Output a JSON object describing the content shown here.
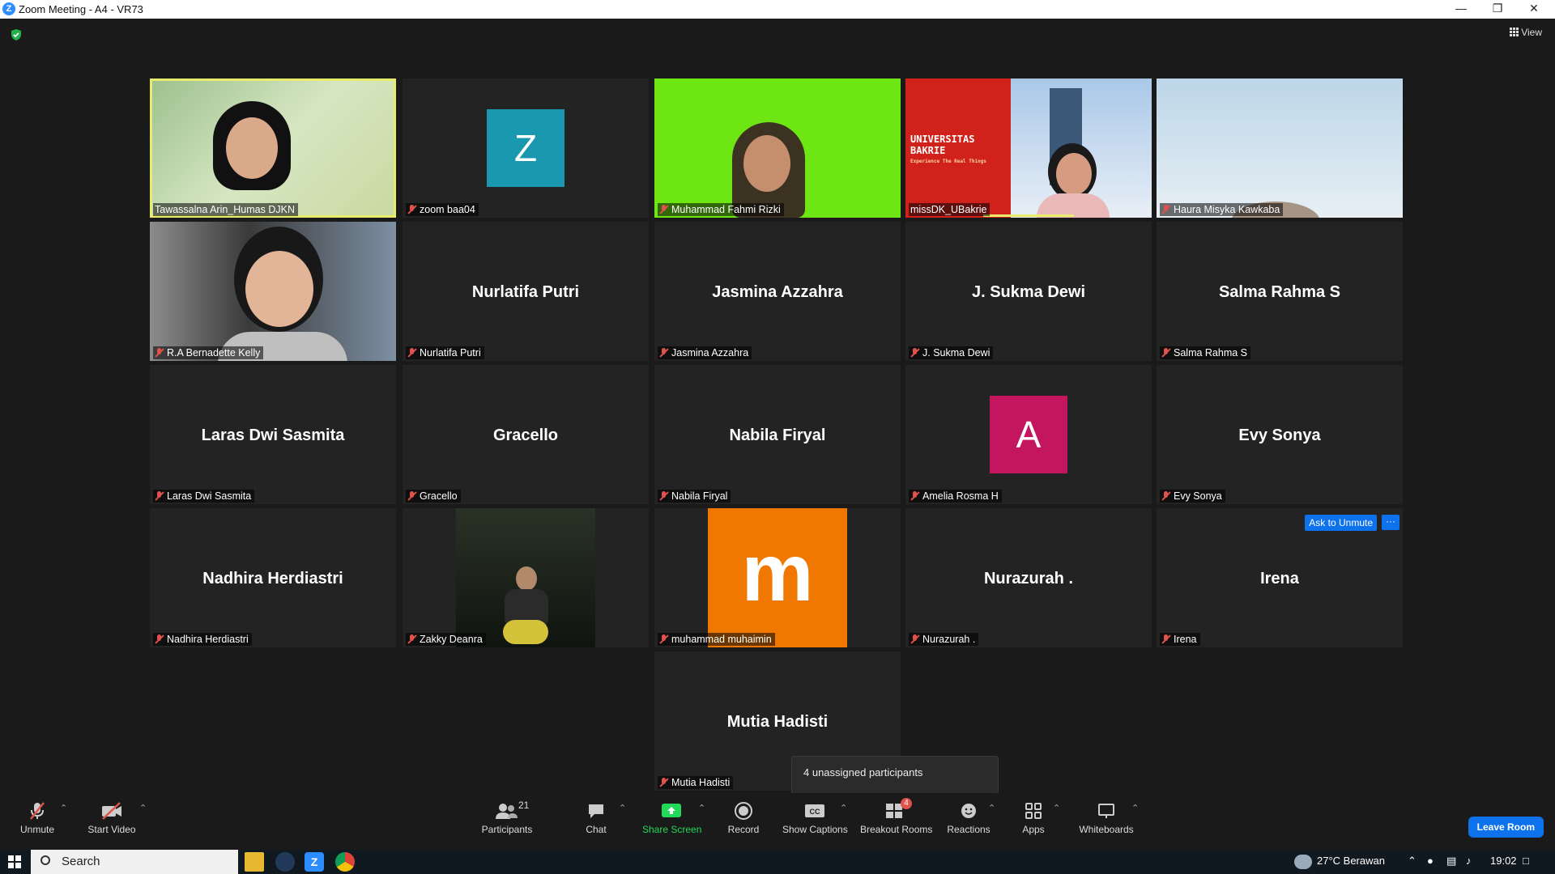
{
  "window": {
    "title": "Zoom Meeting - A4 - VR73",
    "app_letter": "Z"
  },
  "header": {
    "view_label": "View"
  },
  "tiles": [
    {
      "name": "Tawassalna Arin_Humas DJKN",
      "kind": "video"
    },
    {
      "name": "zoom baa04",
      "kind": "avatar",
      "letter": "Z",
      "color": "#1a98b0"
    },
    {
      "name": "Muhammad Fahmi Rizki",
      "kind": "video"
    },
    {
      "name": "missDK_UBakrie",
      "kind": "video",
      "banner_line1": "UNIVERSITAS",
      "banner_line2": "BAKRIE",
      "banner_line3": "Experience The Real Things"
    },
    {
      "name": "Haura Misyka Kawkaba",
      "kind": "video"
    },
    {
      "name": "R.A Bernadette Kelly",
      "kind": "video"
    },
    {
      "name": "Nurlatifa Putri",
      "kind": "name"
    },
    {
      "name": "Jasmina Azzahra",
      "kind": "name"
    },
    {
      "name": "J. Sukma Dewi",
      "kind": "name"
    },
    {
      "name": "Salma Rahma S",
      "kind": "name"
    },
    {
      "name": "Laras Dwi Sasmita",
      "kind": "name"
    },
    {
      "name": "Gracello",
      "kind": "name"
    },
    {
      "name": "Nabila Firyal",
      "kind": "name"
    },
    {
      "name": "Amelia Rosma H",
      "kind": "avatar",
      "letter": "A",
      "color": "#c4165e"
    },
    {
      "name": "Evy Sonya",
      "kind": "name"
    },
    {
      "name": "Nadhira Herdiastri",
      "kind": "name"
    },
    {
      "name": "Zakky Deanra",
      "kind": "video"
    },
    {
      "name": "muhammad muhaimin",
      "kind": "avatar",
      "letter": "m",
      "color": "#f07800"
    },
    {
      "name": "Nurazurah .",
      "kind": "name"
    },
    {
      "name": "Irena",
      "kind": "name"
    },
    {
      "name": "Mutia Hadisti",
      "kind": "name"
    }
  ],
  "irena_actions": {
    "ask_to_unmute": "Ask to Unmute",
    "more": "···"
  },
  "tooltip": "4 unassigned participants",
  "toolbar": {
    "unmute": "Unmute",
    "start_video": "Start Video",
    "participants": "Participants",
    "participants_count": "21",
    "chat": "Chat",
    "share_screen": "Share Screen",
    "record": "Record",
    "show_captions": "Show Captions",
    "breakout_rooms": "Breakout Rooms",
    "breakout_badge": "4",
    "reactions": "Reactions",
    "apps": "Apps",
    "whiteboards": "Whiteboards",
    "leave": "Leave Room",
    "cc_glyph": "CC"
  },
  "taskbar": {
    "search_placeholder": "Search",
    "weather": "27°C  Berawan",
    "time": "19:02"
  },
  "colors": {
    "accent": "#0e72ed",
    "active_speaker": "#e7ec6a",
    "share_green": "#23d959",
    "muted_red": "#e0524b"
  }
}
